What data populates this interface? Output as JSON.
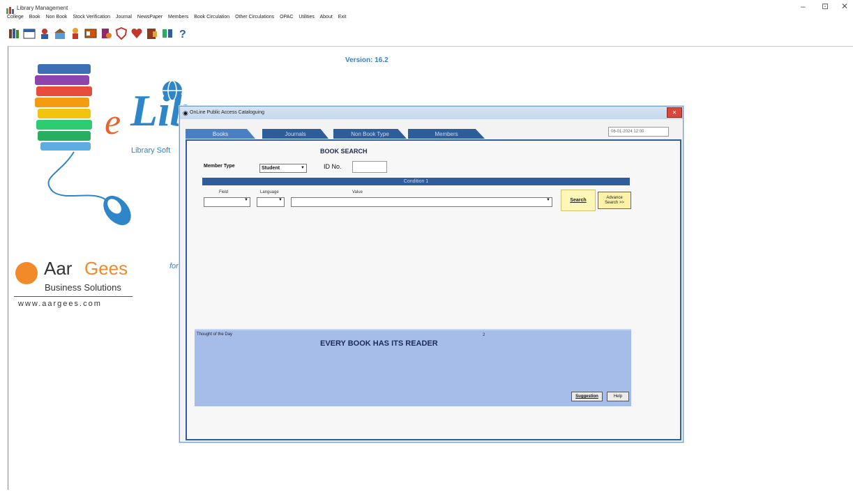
{
  "window": {
    "title": "Library Management",
    "controls": [
      "–",
      "⊡",
      "✕"
    ]
  },
  "menu": [
    "College",
    "Book",
    "Non Book",
    "Stock Verification",
    "Journal",
    "NewsPaper",
    "Members",
    "Book Circulation",
    "Other Circulations",
    "OPAC",
    "Utilities",
    "About",
    "Exit"
  ],
  "toolbar": {
    "icons": [
      "books-icon",
      "calendar-icon",
      "member-icon",
      "library-icon",
      "reader-icon",
      "id-card-icon",
      "book-issue-icon",
      "shield-icon",
      "heart-book-icon",
      "door-book-icon",
      "transfer-icon",
      "help-icon"
    ]
  },
  "version": "Version: 16.2",
  "logo": {
    "e": "e",
    "lib": "Lib",
    "subtitle": "Library Soft"
  },
  "company": {
    "name_a": "Aar",
    "name_b": "Gees",
    "subtitle": "Business Solutions",
    "url": "www.aargees.com",
    "tag": "for"
  },
  "dialog": {
    "title": "OnLine Public Access Cataloguing",
    "close": "✕",
    "tabs": [
      "Books",
      "Journals",
      "Non Book Type",
      "Members"
    ],
    "datetime": "06-01-2024 12:00",
    "heading": "BOOK SEARCH",
    "member_type_label": "Member Type",
    "member_type_value": "Student",
    "idno_label": "ID No.",
    "condition_label": "Condition 1",
    "field_label": "Field",
    "language_label": "Language",
    "value_label": "Value",
    "search_button": "Search",
    "advance_search_button_line1": "Advance",
    "advance_search_button_line2": "Search >>",
    "thought_label": "Thought of the Day",
    "thought_text": "EVERY BOOK HAS ITS READER",
    "thought_number": "2",
    "suggestion_button": "Suggestion",
    "help_button": "Help"
  },
  "colors": {
    "tab_active": "#4b7fc4",
    "tab": "#2e5d9c",
    "thought_bg": "#a7bde9",
    "search_btn": "#fff7b8",
    "brand_orange": "#f28a2a",
    "brand_blue": "#2e86c9"
  }
}
